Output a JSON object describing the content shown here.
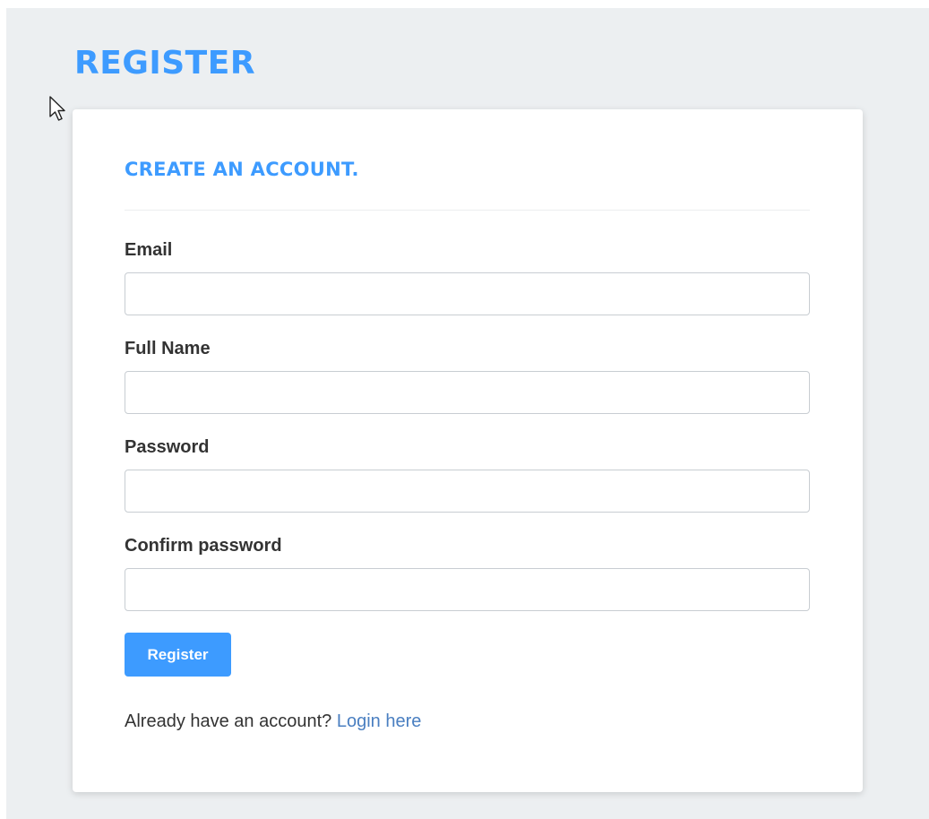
{
  "page": {
    "title": "REGISTER"
  },
  "card": {
    "heading": "CREATE AN ACCOUNT.",
    "fields": [
      {
        "label": "Email",
        "value": "",
        "placeholder": ""
      },
      {
        "label": "Full Name",
        "value": "",
        "placeholder": ""
      },
      {
        "label": "Password",
        "value": "",
        "placeholder": ""
      },
      {
        "label": "Confirm password",
        "value": "",
        "placeholder": ""
      }
    ],
    "submit_label": "Register",
    "footer": {
      "prompt": "Already have an account?",
      "link_label": "Login here"
    }
  },
  "colors": {
    "accent": "#3d9bff",
    "page_bg": "#eceff1",
    "link": "#4a7fc1",
    "text": "#333333"
  },
  "icons": {
    "cursor": "mouse-pointer-icon"
  }
}
